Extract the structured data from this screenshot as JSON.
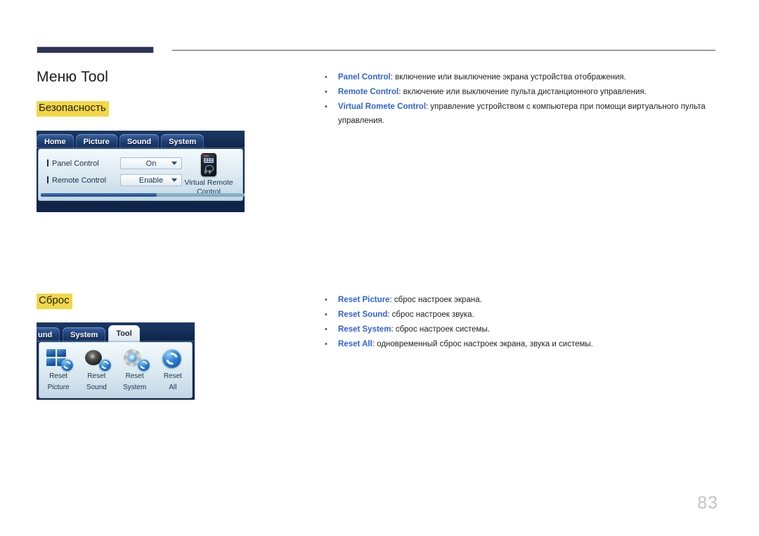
{
  "page": {
    "title": "Меню Tool",
    "number": "83",
    "accent_dark": "#2e3356",
    "highlight": "#f2d745",
    "term_color": "#2f62d8"
  },
  "sections": [
    {
      "heading": "Безопасность",
      "bullets": [
        {
          "term": "Panel Control",
          "text": ": включение или выключение экрана устройства отображения."
        },
        {
          "term": "Remote Control",
          "text": ": включение или выключение пульта дистанционного управления."
        },
        {
          "term": "Virtual Romete Control",
          "text": ": управление устройством с компьютера при помощи виртуального пульта управления."
        }
      ]
    },
    {
      "heading": "Сброс",
      "bullets": [
        {
          "term": "Reset Picture",
          "text": ": сброс настроек экрана."
        },
        {
          "term": "Reset Sound",
          "text": ": сброс настроек звука."
        },
        {
          "term": "Reset System",
          "text": ": сброс настроек системы."
        },
        {
          "term": "Reset All",
          "text": ": одновременный сброс настроек экрана, звука и системы."
        }
      ]
    }
  ],
  "osd_security": {
    "tabs": [
      {
        "label": "Home",
        "active": false
      },
      {
        "label": "Picture",
        "active": false
      },
      {
        "label": "Sound",
        "active": false
      },
      {
        "label": "System",
        "active": false
      }
    ],
    "rows": [
      {
        "label": "Panel Control",
        "value": "On"
      },
      {
        "label": "Remote Control",
        "value": "Enable"
      }
    ],
    "virtual_remote_label_line1": "Virtual Remote",
    "virtual_remote_label_line2": "Control"
  },
  "osd_reset": {
    "tabs": [
      {
        "label": "und",
        "active": false
      },
      {
        "label": "System",
        "active": false
      },
      {
        "label": "Tool",
        "active": true
      }
    ],
    "items": [
      {
        "line1": "Reset",
        "line2": "Picture",
        "icon": "picture-reset-icon"
      },
      {
        "line1": "Reset",
        "line2": "Sound",
        "icon": "sound-reset-icon"
      },
      {
        "line1": "Reset",
        "line2": "System",
        "icon": "system-reset-icon"
      },
      {
        "line1": "Reset",
        "line2": "All",
        "icon": "all-reset-icon"
      }
    ]
  }
}
